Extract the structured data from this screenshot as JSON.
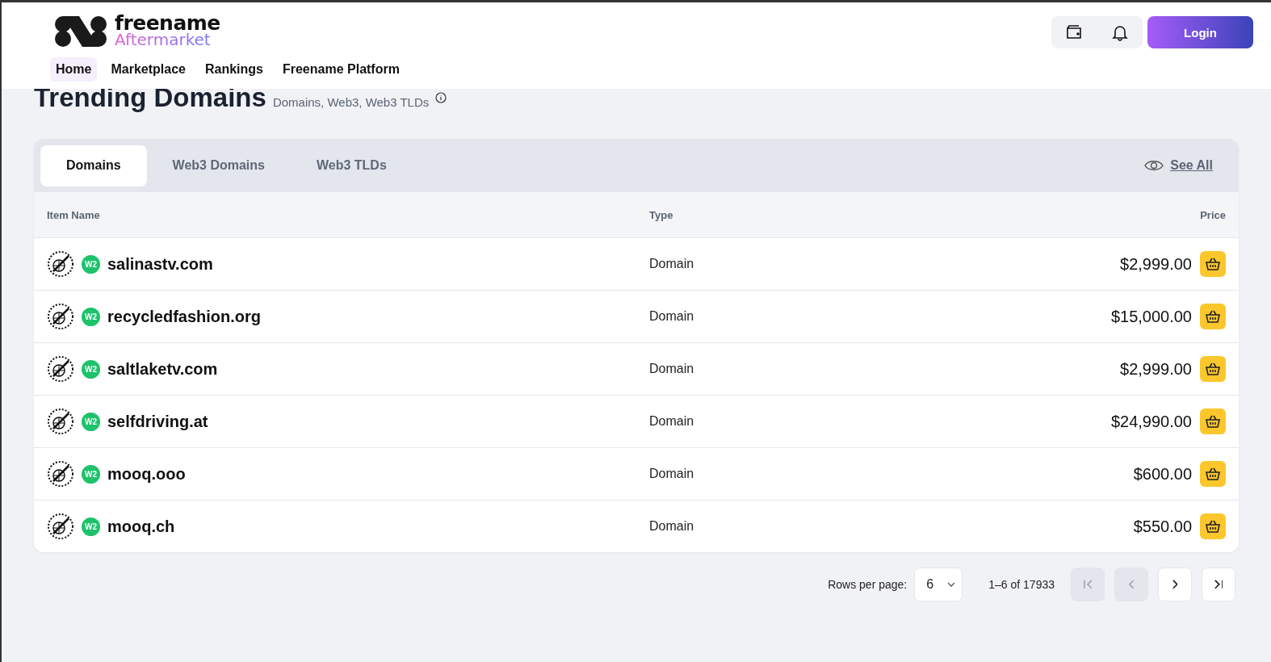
{
  "header": {
    "logo": {
      "name": "freename",
      "subtitle": "Aftermarket"
    },
    "nav": [
      {
        "label": "Home",
        "selected": true
      },
      {
        "label": "Marketplace",
        "selected": false
      },
      {
        "label": "Rankings",
        "selected": false
      },
      {
        "label": "Freename Platform",
        "selected": false
      }
    ],
    "login_button": "Login"
  },
  "page": {
    "title": "Trending Domains",
    "subtitle": "Domains, Web3, Web3 TLDs"
  },
  "tabs": [
    {
      "label": "Domains",
      "selected": true
    },
    {
      "label": "Web3 Domains",
      "selected": false
    },
    {
      "label": "Web3 TLDs",
      "selected": false
    }
  ],
  "see_all": "See All",
  "table": {
    "columns": [
      "Item Name",
      "Type",
      "Price"
    ],
    "rows": [
      {
        "badge": "W2",
        "name": "salinastv.com",
        "type": "Domain",
        "price": "$2,999.00"
      },
      {
        "badge": "W2",
        "name": "recycledfashion.org",
        "type": "Domain",
        "price": "$15,000.00"
      },
      {
        "badge": "W2",
        "name": "saltlaketv.com",
        "type": "Domain",
        "price": "$2,999.00"
      },
      {
        "badge": "W2",
        "name": "selfdriving.at",
        "type": "Domain",
        "price": "$24,990.00"
      },
      {
        "badge": "W2",
        "name": "mooq.ooo",
        "type": "Domain",
        "price": "$600.00"
      },
      {
        "badge": "W2",
        "name": "mooq.ch",
        "type": "Domain",
        "price": "$550.00"
      }
    ]
  },
  "pagination": {
    "rows_per_page_label": "Rows per page:",
    "rows_per_page": "6",
    "range": "1–6 of 17933",
    "buttons": [
      {
        "kind": "first",
        "disabled": true
      },
      {
        "kind": "prev",
        "disabled": true
      },
      {
        "kind": "next",
        "disabled": false
      },
      {
        "kind": "last",
        "disabled": false
      }
    ]
  }
}
